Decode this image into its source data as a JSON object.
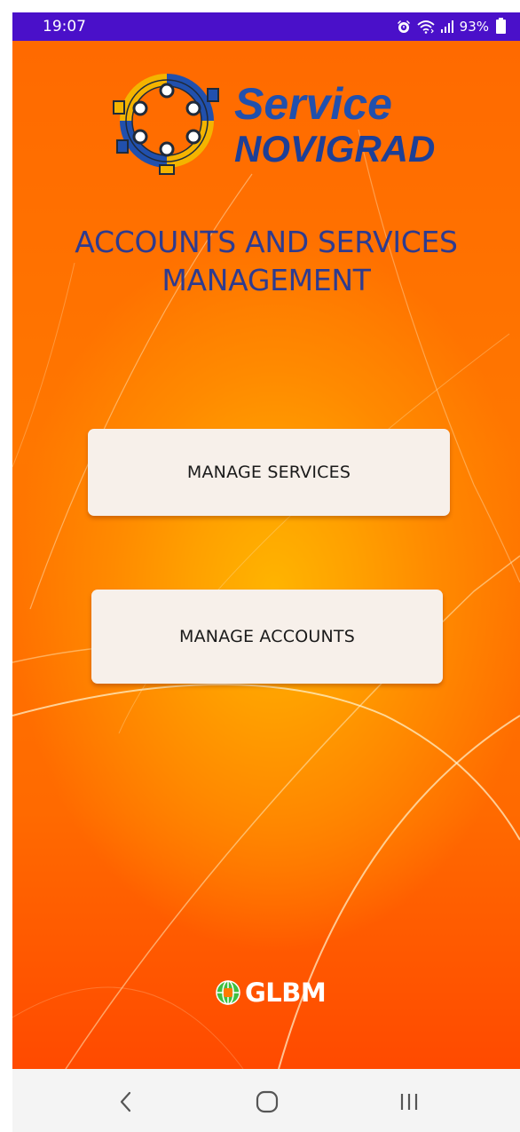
{
  "status_bar": {
    "time": "19:07",
    "battery_percent": "93%",
    "icons": [
      "alarm-icon",
      "wifi-icon",
      "signal-icon",
      "battery-icon"
    ],
    "background_color": "#4a10c9"
  },
  "app": {
    "logo": {
      "line1": "Service",
      "line2": "NOVIGRAD",
      "icon": "gears-network-icon"
    },
    "title": {
      "line1": "ACCOUNTS AND SERVICES",
      "line2": "MANAGEMENT"
    },
    "buttons": {
      "manage_services": "MANAGE SERVICES",
      "manage_accounts": "MANAGE ACCOUNTS"
    },
    "footer": {
      "brand": "GLBM",
      "icon": "globe-icon"
    },
    "colors": {
      "background_primary": "#ff7a00",
      "background_center": "#ffb400",
      "title_color": "#2e3b8f",
      "button_background": "#f7f0ea",
      "logo_color": "#2150ad"
    }
  },
  "nav_bar": {
    "icons": [
      "back-icon",
      "home-icon",
      "recent-apps-icon"
    ]
  }
}
